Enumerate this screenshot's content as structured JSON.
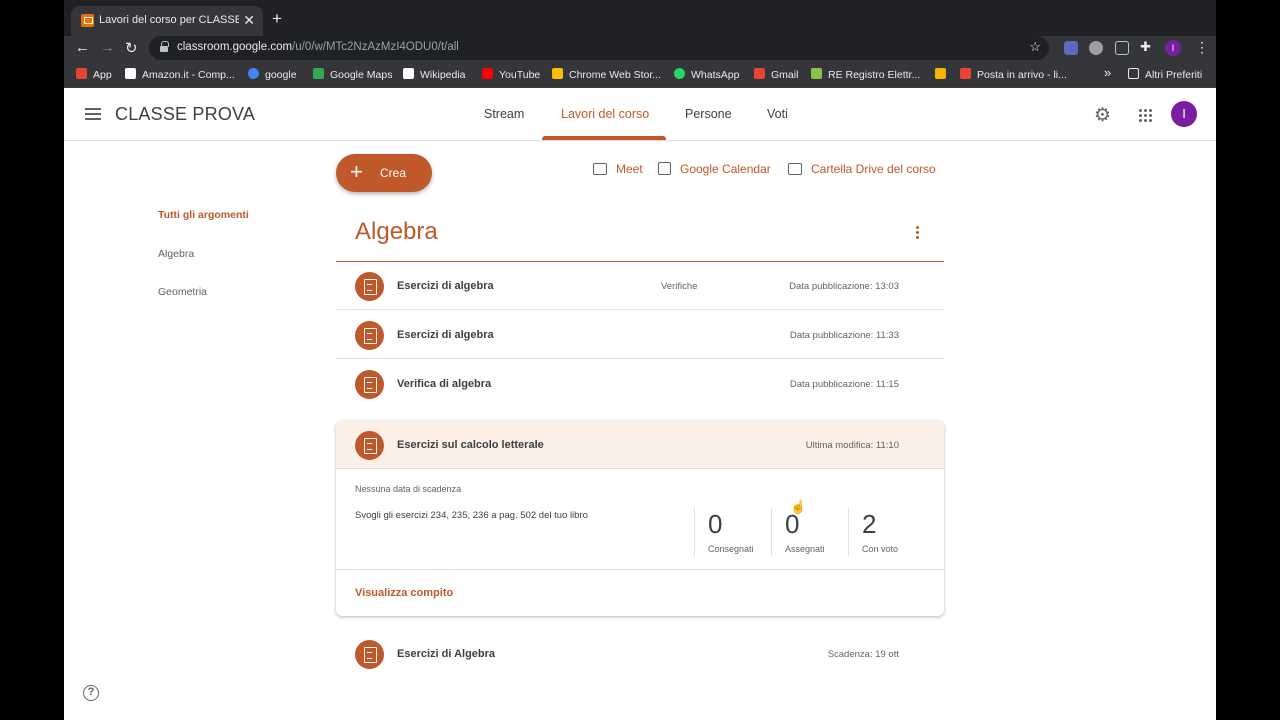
{
  "browser": {
    "tab_title": "Lavori del corso per CLASSE PROVA",
    "tab_close": "✕",
    "new_tab": "+",
    "url_host": "classroom.google.com",
    "url_path": "/u/0/w/MTc2NzAzMzI4ODU0/t/all",
    "profile_initial": "I",
    "bookmarks": [
      {
        "label": "App",
        "color": "#ea4335"
      },
      {
        "label": "Amazon.it - Comp...",
        "color": "#ffffff"
      },
      {
        "label": "google",
        "color": "#4285f4"
      },
      {
        "label": "Google Maps",
        "color": "#34a853"
      },
      {
        "label": "Wikipedia",
        "color": "#ffffff"
      },
      {
        "label": "YouTube",
        "color": "#ff0000"
      },
      {
        "label": "Chrome Web Stor...",
        "color": "#fbbc04"
      },
      {
        "label": "WhatsApp",
        "color": "#25d366"
      },
      {
        "label": "Gmail",
        "color": "#ea4335"
      },
      {
        "label": "RE Registro Elettr...",
        "color": "#8bc34a"
      },
      {
        "label": "",
        "color": "#f4b400"
      },
      {
        "label": "Posta in arrivo - li...",
        "color": "#ea4335"
      }
    ],
    "bookmarks_overflow": "»",
    "other_bookmarks": "Altri Preferiti"
  },
  "app": {
    "class_name": "CLASSE PROVA",
    "tabs": [
      "Stream",
      "Lavori del corso",
      "Persone",
      "Voti"
    ],
    "user_initial": "I",
    "accent": "#c0582a"
  },
  "toolbar": {
    "create_label": "Crea",
    "meet_label": "Meet",
    "calendar_label": "Google Calendar",
    "drive_label": "Cartella Drive del corso"
  },
  "sidebar": {
    "items": [
      "Tutti gli argomenti",
      "Algebra",
      "Geometria"
    ]
  },
  "topic": {
    "title": "Algebra",
    "rows": [
      {
        "title": "Esercizi di algebra",
        "tag": "Verifiche",
        "date": "Data pubblicazione: 13:03"
      },
      {
        "title": "Esercizi di algebra",
        "tag": "",
        "date": "Data pubblicazione: 11:33"
      },
      {
        "title": "Verifica di algebra",
        "tag": "",
        "date": "Data pubblicazione: 11:15"
      }
    ],
    "expanded": {
      "title": "Esercizi sul calcolo letterale",
      "date": "Ultima modifica: 11:10",
      "due": "Nessuna data di scadenza",
      "description": "Svogli gli esercizi 234, 235, 236 a pag. 502 del tuo libro",
      "stats": [
        {
          "value": "0",
          "label": "Consegnati"
        },
        {
          "value": "0",
          "label": "Assegnati"
        },
        {
          "value": "2",
          "label": "Con voto"
        }
      ],
      "view_label": "Visualizza compito"
    },
    "last_row": {
      "title": "Esercizi di Algebra",
      "date": "Scadenza: 19 ott"
    }
  },
  "help_label": "?"
}
